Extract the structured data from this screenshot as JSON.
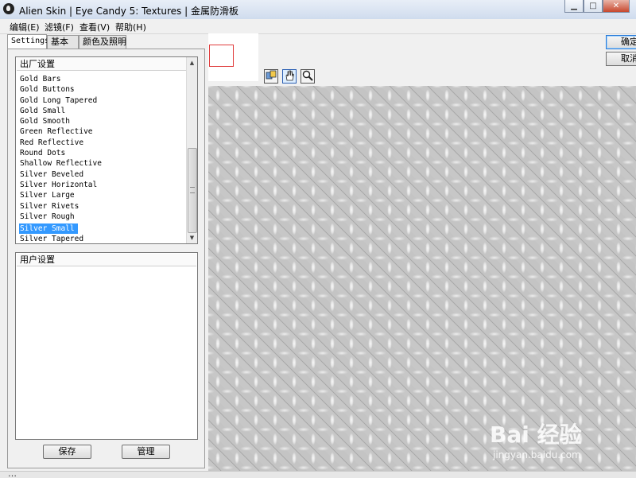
{
  "window": {
    "title": "Alien Skin | Eye Candy 5: Textures | 金属防滑板",
    "minimize_glyph": "▁",
    "maximize_glyph": "□",
    "close_glyph": "✕"
  },
  "menu": {
    "items": [
      "编辑(E)",
      "滤镜(F)",
      "查看(V)",
      "帮助(H)"
    ]
  },
  "tabs": [
    "Settings",
    "基本",
    "颜色及照明"
  ],
  "factory_settings": {
    "header": "出厂设置",
    "items": [
      "Gold Bars",
      "Gold Buttons",
      "Gold Long Tapered",
      "Gold Small",
      "Gold Smooth",
      "Green Reflective",
      "Red Reflective",
      "Round Dots",
      "Shallow Reflective",
      "Silver Beveled",
      "Silver Horizontal",
      "Silver Large",
      "Silver Rivets",
      "Silver Rough",
      "Silver Small",
      "Silver Tapered"
    ],
    "selected": "Silver Small"
  },
  "user_settings": {
    "header": "用户设置"
  },
  "buttons": {
    "save": "保存",
    "manage": "管理",
    "ok": "确定",
    "cancel": "取消"
  },
  "watermark": {
    "main": "Bai 经验",
    "sub": "jingyan.baidu.com"
  },
  "status": {
    "text": "…"
  },
  "icons": {
    "app": "alien-skin-logo-icon",
    "tools": [
      "preview-toggle-icon",
      "hand-tool-icon",
      "zoom-tool-icon"
    ]
  },
  "colors": {
    "selection": "#3399ff",
    "preview_frame": "#e03c3c"
  }
}
